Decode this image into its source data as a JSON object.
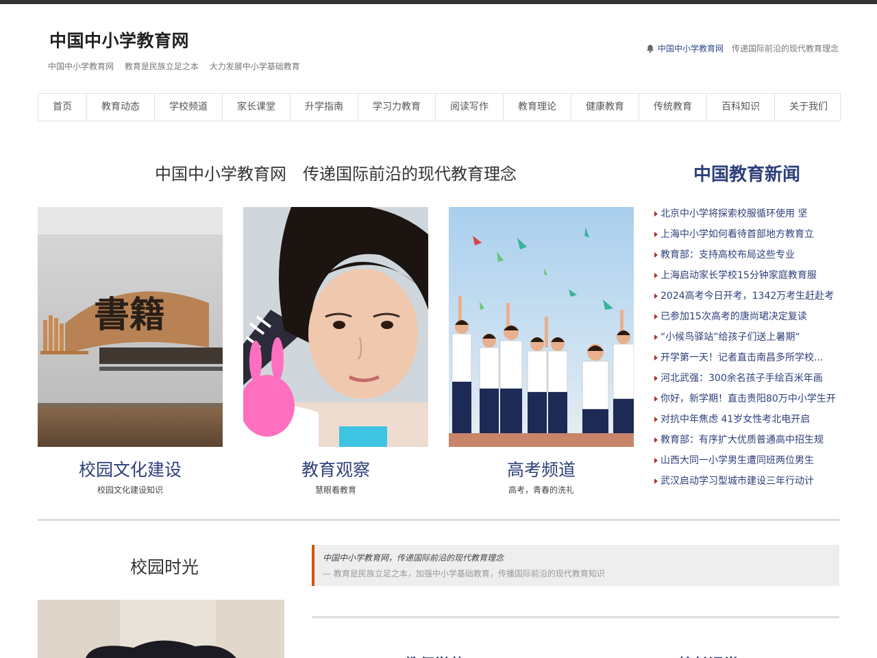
{
  "site": {
    "logo": "中国中小学教育网",
    "tagline": [
      "中国中小学教育网",
      "教育是民族立足之本",
      "大力发展中小学基础教育"
    ],
    "notice_site": "中国中小学教育网",
    "notice_text": "传递国际前沿的现代教育理念",
    "notice_icon": "bell-icon"
  },
  "nav": [
    "首页",
    "教育动态",
    "学校频道",
    "家长课堂",
    "升学指南",
    "学习力教育",
    "阅读写作",
    "教育理论",
    "健康教育",
    "传统教育",
    "百科知识",
    "关于我们"
  ],
  "main": {
    "title": "中国中小学教育网　传递国际前沿的现代教育理念",
    "cards": [
      {
        "name": "校园文化建设",
        "sub": "校园文化建设知识",
        "image_text": "書籍"
      },
      {
        "name": "教育观察",
        "sub": "慧眼看教育"
      },
      {
        "name": "高考频道",
        "sub": "高考，青春的洗礼"
      }
    ]
  },
  "news": {
    "title": "中国教育新闻",
    "items": [
      "北京中小学将探索校服循环使用 坚",
      "上海中小学如何看待首部地方教育立",
      "教育部：支持高校布局这些专业",
      "上海启动家长学校15分钟家庭教育服",
      "2024高考今日开考，1342万考生赶赴考",
      "已参加15次高考的唐尚珺决定复读",
      "“小候鸟驿站”给孩子们送上暑期“",
      "开学第一天！记者直击南昌多所学校...",
      "河北武强：300余名孩子手绘百米年画",
      "你好，新学期！直击贵阳80万中小学生开",
      "对抗中年焦虑 41岁女性考北电开启",
      "教育部：有序扩大优质普通高中招生规",
      "山西大同一小学男生遭同班两位男生",
      "武汉启动学习型城市建设三年行动计"
    ]
  },
  "bottom": {
    "side_title": "校园时光",
    "quote_line1": "中国中小学教育网，传递国际前沿的现代教育理念",
    "quote_line2": "— 教育是民族立足之本，加强中小学基础教育，传播国际前沿的现代教育知识",
    "col1_title": "教师学苑",
    "col2_title": "校长课堂"
  },
  "colors": {
    "accent": "#2d3f7a",
    "quote_border": "#d35400",
    "topbar": "#333333"
  }
}
